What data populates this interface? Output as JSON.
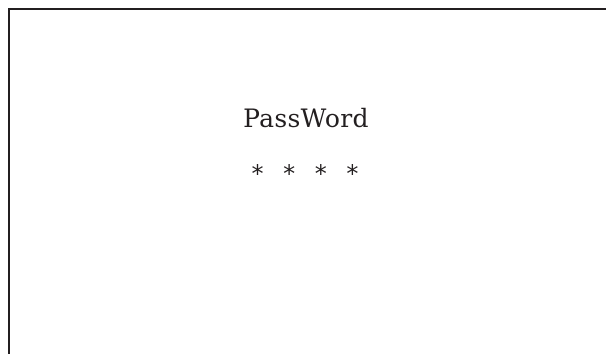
{
  "password_field": {
    "label": "PassWord",
    "masked_value": "* * * *"
  }
}
